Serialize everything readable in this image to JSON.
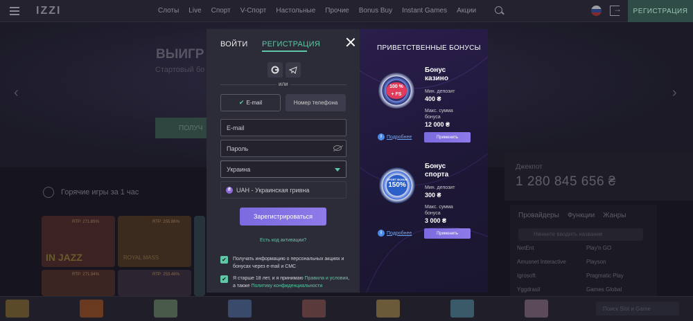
{
  "header": {
    "logo": "IZZI",
    "nav": [
      "Слоты",
      "Live",
      "Спорт",
      "V-Спорт",
      "Настольные",
      "Прочие",
      "Bonus Buy",
      "Instant Games",
      "Акции"
    ],
    "register_label": "РЕГИСТРАЦИЯ"
  },
  "background": {
    "hero_title": "ВЫИГР",
    "hero_subtitle": "Стартовый бо",
    "hero_button": "ПОЛУЧ",
    "hot_games_title": "Горячие игры за 1 час",
    "tile_badges": [
      "RTP: 271.85%",
      "RTP: 271.94%",
      "RTP: 255.86%",
      "RTP: 253.48%"
    ],
    "tile_names": [
      "IN JAZZ",
      "ROYAL MASS"
    ],
    "jackpot_label": "Джекпот",
    "jackpot_value": "1 280 845 656 ₴",
    "providers_tabs": [
      "Провайдеры",
      "Функции",
      "Жанры"
    ],
    "providers_search_placeholder": "Начните вводить название",
    "providers": [
      "NetEnt",
      "Play'n GO",
      "Amusnet Interactive",
      "Playson",
      "Igrosoft",
      "Pragmatic Play",
      "Yggdrasil",
      "Games Global"
    ],
    "bottom_search_placeholder": "Поиск Slot и Game"
  },
  "modal": {
    "tab_login": "ВОЙТИ",
    "tab_register": "РЕГИСТРАЦИЯ",
    "or_label": "или",
    "method_email": "E-mail",
    "method_phone": "Номер телефона",
    "email_placeholder": "E-mail",
    "password_placeholder": "Пароль",
    "country_value": "Украина",
    "currency_value": "UAH - Украинская гривна",
    "currency_symbol": "₴",
    "submit_label": "Зарегистрироваться",
    "promo_link": "Есть код активации?",
    "consent1": "Получать информацию о персональных акциях и бонусах через e-mail и СМС",
    "consent2_prefix": "Я старше 18 лет, и я принимаю",
    "consent2_link1": "Правила и условия",
    "consent2_mid": ", а также",
    "consent2_link2": "Политику конфиденциальности",
    "check_glyph": "✔"
  },
  "bonuses": {
    "heading": "ПРИВЕТСТВЕННЫЕ БОНУСЫ",
    "casino": {
      "title_line1": "Бонус",
      "title_line2": "казино",
      "coin_text_1": "100 %",
      "coin_text_2": "+ FS",
      "min_deposit_label": "Мин. депозит",
      "min_deposit": "400 ₴",
      "max_sum_label_1": "Макс. сумма",
      "max_sum_label_2": "бонуса",
      "max_sum": "12 000 ₴",
      "more_label": "Подробнее",
      "apply_label": "Применить"
    },
    "sport": {
      "title_line1": "Бонус",
      "title_line2": "спорта",
      "coin_text_1": "SPORT BONUS",
      "coin_text_2": "150%",
      "min_deposit_label": "Мин. депозит",
      "min_deposit": "300 ₴",
      "max_sum_label_1": "Макс. сумма",
      "max_sum_label_2": "бонуса",
      "max_sum": "3 000 ₴",
      "more_label": "Подробнее",
      "apply_label": "Применить"
    }
  },
  "colors": {
    "accent": "#5fc7a5",
    "button_purple": "#7a6be0",
    "modal_bg": "#2c2b38"
  }
}
